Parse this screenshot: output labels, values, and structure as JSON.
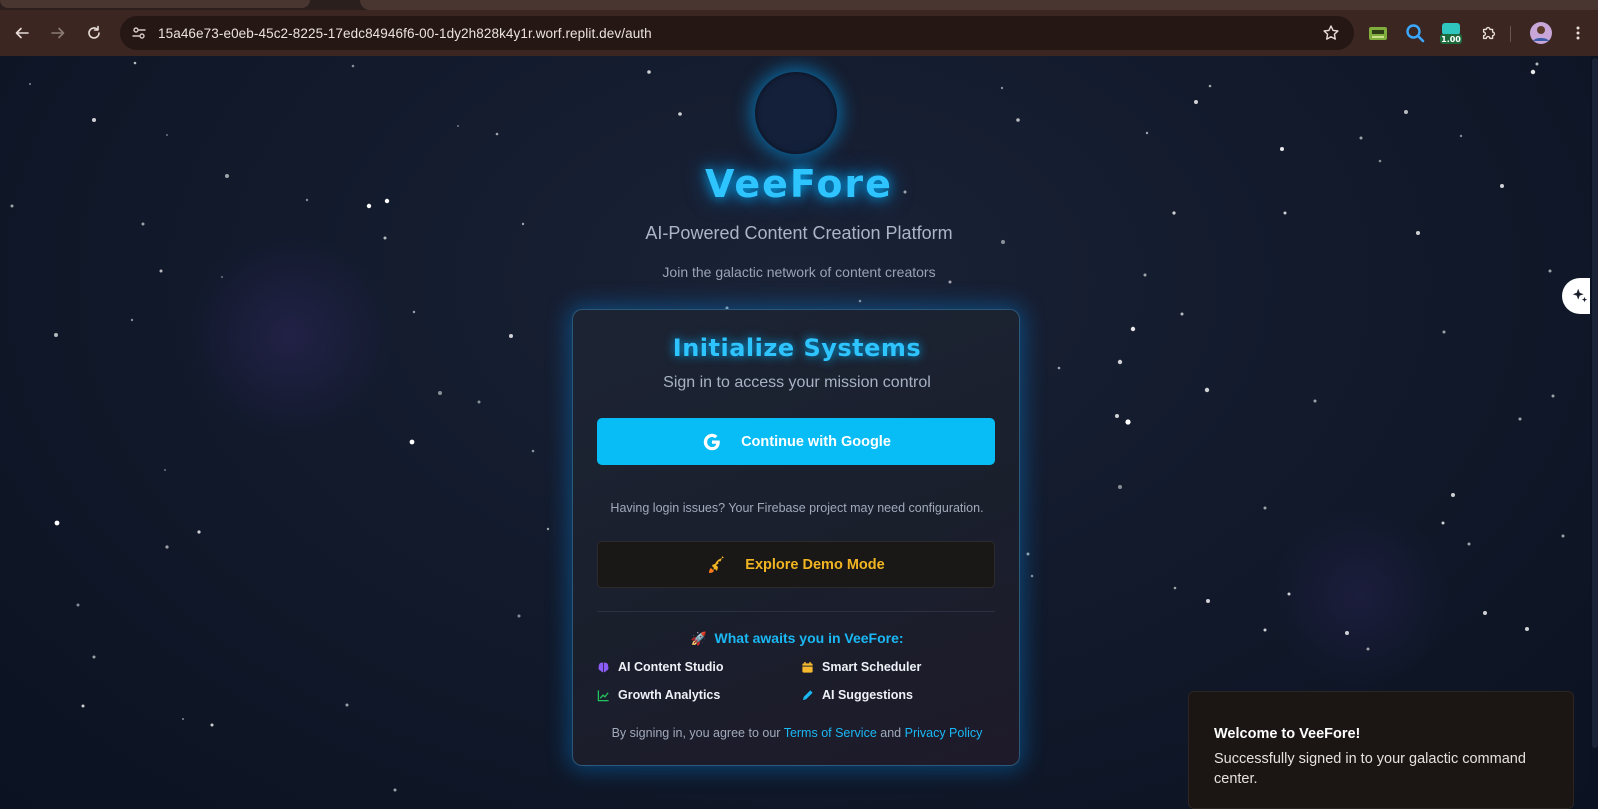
{
  "browser": {
    "url": "15a46e73-e0eb-45c2-8225-17edc84946f6-00-1dy2h828k4y1r.worf.replit.dev/auth",
    "extensions": [
      {
        "name": "cash-register-extension-icon"
      },
      {
        "name": "magnifier-extension-icon"
      },
      {
        "name": "badge-extension-icon",
        "badge": "1.00"
      },
      {
        "name": "puzzle-extensions-icon"
      }
    ]
  },
  "hero": {
    "brand": "VeeFore",
    "tagline": "AI-Powered Content Creation Platform",
    "subtagline": "Join the galactic network of content creators"
  },
  "card": {
    "title": "Initialize Systems",
    "subtitle": "Sign in to access your mission control",
    "google_button": "Continue with Google",
    "issues_text": "Having login issues? Your Firebase project may need configuration.",
    "demo_button": "Explore Demo Mode",
    "awaits_emoji": "🚀",
    "awaits_title": "What awaits you in VeeFore:",
    "features": [
      {
        "label": "AI Content Studio",
        "icon": "brain-icon",
        "color": "#8b5cf6"
      },
      {
        "label": "Smart Scheduler",
        "icon": "calendar-icon",
        "color": "#f5b82e"
      },
      {
        "label": "Growth Analytics",
        "icon": "chart-icon",
        "color": "#22c55e"
      },
      {
        "label": "AI Suggestions",
        "icon": "pen-icon",
        "color": "#1ab8f5"
      }
    ],
    "terms_prefix": "By signing in, you agree to our",
    "terms_link": "Terms of Service",
    "terms_and": "and",
    "privacy_link": "Privacy Policy"
  },
  "toast": {
    "title": "Welcome to VeeFore!",
    "body": "Successfully signed in to your galactic command center."
  },
  "colors": {
    "accent": "#08bcf5",
    "demo_accent": "#f2b522",
    "background": "#121a2c"
  }
}
